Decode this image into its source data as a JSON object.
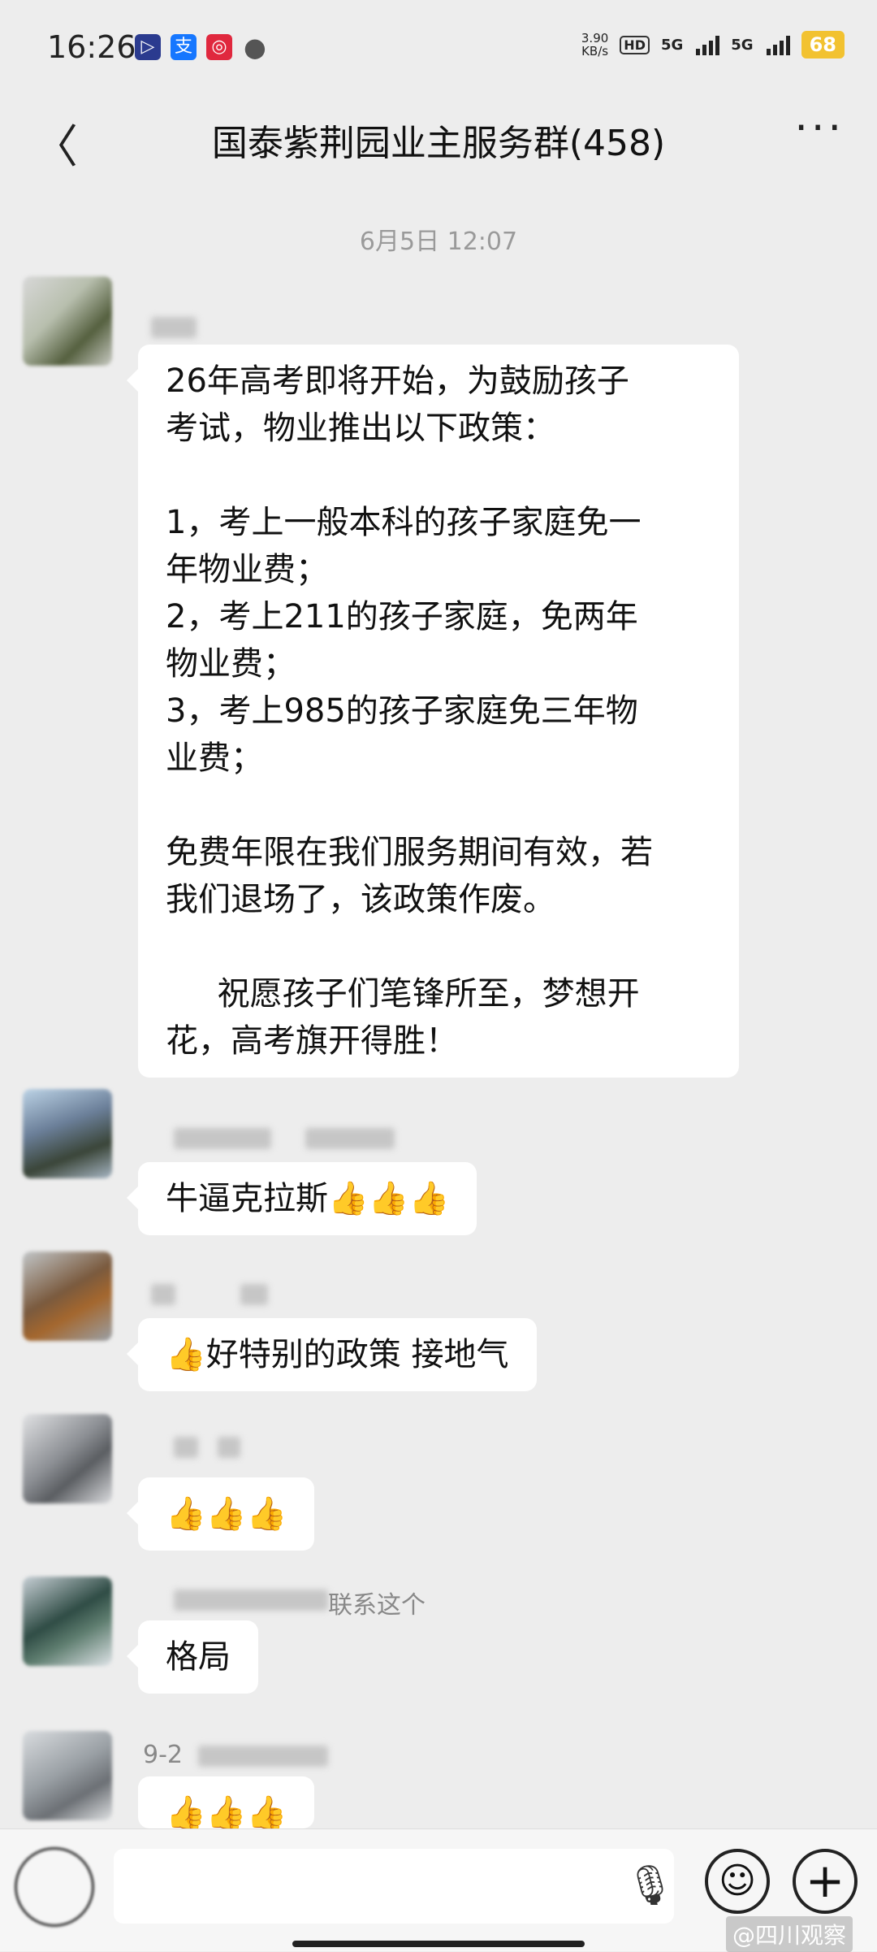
{
  "status_bar": {
    "time": "16:26",
    "apps": [
      {
        "icon": "player-app-icon",
        "glyph": "▷",
        "color": "#2b3b8f"
      },
      {
        "icon": "alipay-app-icon",
        "glyph": "支",
        "color": "#1677ff"
      },
      {
        "icon": "red-app-icon",
        "glyph": "◎",
        "color": "#e0283e"
      },
      {
        "icon": "chat-app-icon",
        "glyph": "●",
        "color": "#555555"
      }
    ],
    "net_speed_value": "3.90",
    "net_speed_unit": "KB/s",
    "hd_label": "HD",
    "sim1_label": "5G",
    "sim2_label": "5G",
    "battery": "68"
  },
  "nav": {
    "back_glyph": "〈",
    "title": "国泰紫荆园业主服务群(458)",
    "more_glyph": "···"
  },
  "timestamp": "6月5日 12:07",
  "messages": [
    {
      "lines": [
        "26年高考即将开始，为鼓励孩子",
        "考试，物业推出以下政策：",
        "",
        "1，考上一般本科的孩子家庭免一",
        "年物业费；",
        "2，考上211的孩子家庭，免两年",
        "物业费；",
        "3，考上985的孩子家庭免三年物",
        "业费；",
        "",
        "免费年限在我们服务期间有效，若",
        "我们退场了，该政策作废。",
        "",
        "     祝愿孩子们笔锋所至，梦想开",
        "花，高考旗开得胜！"
      ]
    },
    {
      "text": "牛逼克拉斯👍👍👍"
    },
    {
      "text": "👍好特别的政策  接地气"
    },
    {
      "text": "👍👍👍"
    },
    {
      "name_suffix": "联系这个",
      "text": "格局"
    },
    {
      "name_prefix": "9-2",
      "text": "👍👍👍"
    }
  ],
  "input_bar": {
    "mic_glyph": "🎙",
    "emoji_glyph": "☺",
    "plus_glyph": "+"
  },
  "watermark": "@四川观察"
}
